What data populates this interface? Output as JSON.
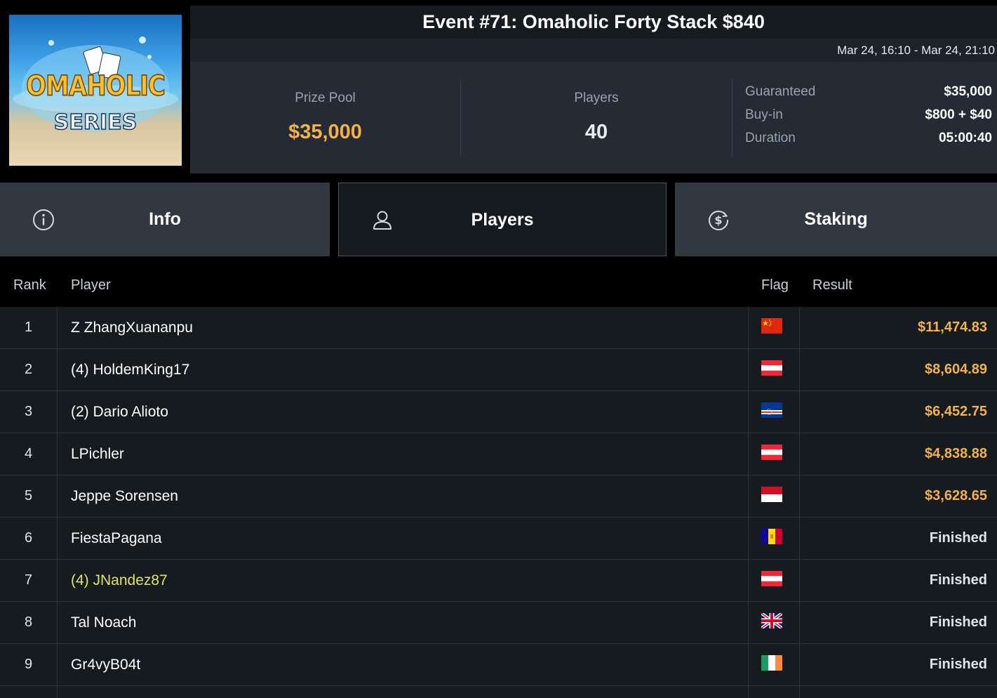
{
  "event": {
    "logo_title": "OMAHOLIC",
    "logo_subtitle": "SERIES",
    "title": "Event #71: Omaholic Forty Stack $840",
    "dates": "Mar 24, 16:10 - Mar 24, 21:10"
  },
  "stats": {
    "prize_pool_label": "Prize Pool",
    "prize_pool_value": "$35,000",
    "players_label": "Players",
    "players_value": "40",
    "details": [
      {
        "label": "Guaranteed",
        "value": "$35,000"
      },
      {
        "label": "Buy-in",
        "value": "$800 + $40"
      },
      {
        "label": "Duration",
        "value": "05:00:40"
      }
    ]
  },
  "tabs": [
    {
      "label": "Info",
      "icon": "info-icon"
    },
    {
      "label": "Players",
      "icon": "user-icon",
      "active": true
    },
    {
      "label": "Staking",
      "icon": "dollar-coin-icon"
    }
  ],
  "table": {
    "headers": {
      "rank": "Rank",
      "player": "Player",
      "flag": "Flag",
      "result": "Result"
    },
    "rows": [
      {
        "rank": "1",
        "player": "Z ZhangXuananpu",
        "flag": "china",
        "result": "$11,474.83",
        "type": "money"
      },
      {
        "rank": "2",
        "player": "(4) HoldemKing17",
        "flag": "austria",
        "result": "$8,604.89",
        "type": "money"
      },
      {
        "rank": "3",
        "player": "(2) Dario Alioto",
        "flag": "cape-verde",
        "result": "$6,452.75",
        "type": "money"
      },
      {
        "rank": "4",
        "player": "LPichler",
        "flag": "austria",
        "result": "$4,838.88",
        "type": "money"
      },
      {
        "rank": "5",
        "player": "Jeppe Sorensen",
        "flag": "monaco",
        "result": "$3,628.65",
        "type": "money"
      },
      {
        "rank": "6",
        "player": "FiestaPagana",
        "flag": "andorra",
        "result": "Finished",
        "type": "finished"
      },
      {
        "rank": "7",
        "player": "(4) JNandez87",
        "flag": "austria",
        "result": "Finished",
        "type": "finished",
        "highlight": true
      },
      {
        "rank": "8",
        "player": "Tal Noach",
        "flag": "united-kingdom",
        "result": "Finished",
        "type": "finished"
      },
      {
        "rank": "9",
        "player": "Gr4vyB04t",
        "flag": "ireland",
        "result": "Finished",
        "type": "finished"
      }
    ]
  },
  "colors": {
    "money": "#f2b24a",
    "highlight_player": "#e2e26a",
    "row_bg": "#161b20",
    "tab_bg": "#313842"
  }
}
